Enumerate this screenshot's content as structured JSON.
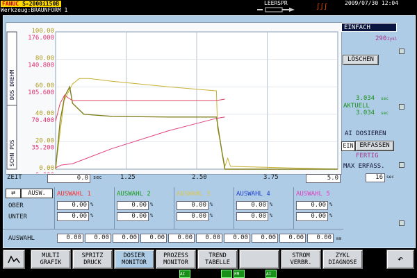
{
  "header": {
    "brand": "FANUC",
    "model": "S-2000i150B",
    "werkzeug_label": "Werkzeug:",
    "werkzeug_value": "BRAUNFORM 1",
    "mode_text": "LEERSPR",
    "datetime": "2009/07/30 12:04"
  },
  "right_panel": {
    "mode": "EINFACH",
    "cycles": "290",
    "cycles_unit": "Zykl",
    "loeschen": "LÖSCHEN",
    "value_top": "3.034",
    "value_top_unit": "sec",
    "aktuell_label": "AKTUELL",
    "value_aktuell": "3.034",
    "value_aktuell_unit": "sec",
    "ai_dosieren": "AI DOSIEREN",
    "ein": "EIN",
    "erfassen": "ERFASSEN",
    "fertig": "FERTIG",
    "max_erfass": "MAX ERFASS.",
    "max_erfass_value": "16",
    "max_erfass_unit": "sec"
  },
  "chart_axes": {
    "left_label_top": "DOS DREHM",
    "left_label_bottom": "SCHN POS",
    "y_left_olive": [
      "100.00",
      "80.00",
      "60.00",
      "40.00",
      "20.00",
      "0.00"
    ],
    "y_left_red": [
      "176.000",
      "140.800",
      "105.600",
      "70.400",
      "35.200",
      "0.000"
    ],
    "x_label": "ZEIT",
    "x_start": "0.0",
    "x_unit": "sec",
    "x_ticks": [
      "1.25",
      "2.50",
      "3.75"
    ],
    "x_end": "5.0"
  },
  "chart_data": {
    "type": "line",
    "xlim": [
      0,
      5
    ],
    "ylim": [
      0,
      100
    ],
    "x_tick_labels": [
      "0.0",
      "1.25",
      "2.50",
      "3.75",
      "5.0"
    ],
    "y_tick_labels_left": [
      "0.00",
      "20.00",
      "40.00",
      "60.00",
      "80.00",
      "100.00"
    ],
    "y_tick_labels_secondary": [
      "0.000",
      "35.200",
      "70.400",
      "105.600",
      "140.800",
      "176.000"
    ],
    "series": [
      {
        "color": "#c8b030",
        "x": [
          0,
          0.15,
          0.3,
          0.42,
          0.6,
          1.0,
          2.0,
          2.85,
          2.87,
          3.0,
          3.05,
          3.1,
          5.0
        ],
        "y": [
          1,
          50,
          62,
          66,
          66,
          64,
          60,
          57,
          30,
          2,
          8,
          2,
          0
        ]
      },
      {
        "color": "#808020",
        "x": [
          0,
          0.08,
          0.16,
          0.25,
          0.3,
          0.5,
          1.0,
          2.0,
          2.85,
          2.95,
          3.0,
          5.0
        ],
        "y": [
          0,
          35,
          53,
          60,
          48,
          40,
          38.5,
          38,
          38,
          12,
          0,
          0
        ]
      },
      {
        "color": "#e04080",
        "x": [
          0,
          0.1,
          0.3,
          1.0,
          2.0,
          2.85,
          3.0
        ],
        "y": [
          1,
          3,
          4,
          15,
          28,
          37,
          38
        ]
      },
      {
        "color": "#e04060",
        "x": [
          0,
          0.08,
          0.16,
          0.22,
          0.3,
          1.0,
          2.0,
          2.85,
          3.0
        ],
        "y": [
          35,
          48,
          54,
          52,
          50,
          50,
          50,
          50,
          51
        ]
      }
    ]
  },
  "selection": {
    "ausw_label": "AUSW.",
    "columns": [
      {
        "name": "AUSWAHL 1",
        "color": "#ff3030"
      },
      {
        "name": "AUSWAHL 2",
        "color": "#1a9a1a"
      },
      {
        "name": "AUSWAHL 3",
        "color": "#d8c850"
      },
      {
        "name": "AUSWAHL 4",
        "color": "#2040d0"
      },
      {
        "name": "AUSWAHL 5",
        "color": "#e040c0"
      }
    ],
    "ober_label": "OBER",
    "unter_label": "UNTER",
    "ober_values": [
      "0.00",
      "0.00",
      "0.00",
      "0.00",
      "0.00"
    ],
    "unter_values": [
      "0.00",
      "0.00",
      "0.00",
      "0.00",
      "0.00"
    ],
    "pct": "%",
    "auswahl_label": "AUSWAHL",
    "auswahl_values": [
      "0.00",
      "0.00",
      "0.00",
      "0.00",
      "0.00",
      "0.00",
      "0.00",
      "0.00",
      "0.00",
      "0.00"
    ],
    "auswahl_unit": "mm"
  },
  "nav": {
    "multi_grafik": [
      "MULTI",
      "GRAFIK"
    ],
    "spritz_druck": [
      "SPRITZ",
      "DRUCK"
    ],
    "dosier_monitor": [
      "DOSIER",
      "MONITOR"
    ],
    "prozess_monitor": [
      "PROZESS",
      "MONITOR"
    ],
    "trend_tabelle": [
      "TREND",
      "TABELLE"
    ],
    "strom_verbr": [
      "STROM",
      "VERBR."
    ],
    "zykl_diagnose": [
      "ZYKL",
      "DIAGNOSE"
    ]
  },
  "status": {
    "ai": "AI",
    "fm": "FM",
    "ai2": "AI"
  }
}
